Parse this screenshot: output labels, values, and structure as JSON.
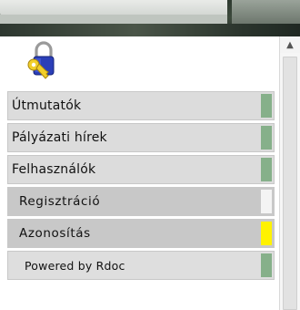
{
  "menu": {
    "items": [
      {
        "label": "Útmutatók"
      },
      {
        "label": "Pályázati hírek"
      },
      {
        "label": "Felhasználók"
      },
      {
        "label": "Regisztráció"
      },
      {
        "label": "Azonosítás"
      },
      {
        "label": "Powered by Rdoc"
      }
    ]
  },
  "icons": {
    "lock": "padlock-with-key-icon",
    "scroll_up": "chevron-up-icon"
  },
  "colors": {
    "indicator_green": "#86b08a",
    "indicator_active": "#fff200",
    "menu_bg": "#dcdcdc",
    "sub_bg": "#c8c8c8"
  }
}
